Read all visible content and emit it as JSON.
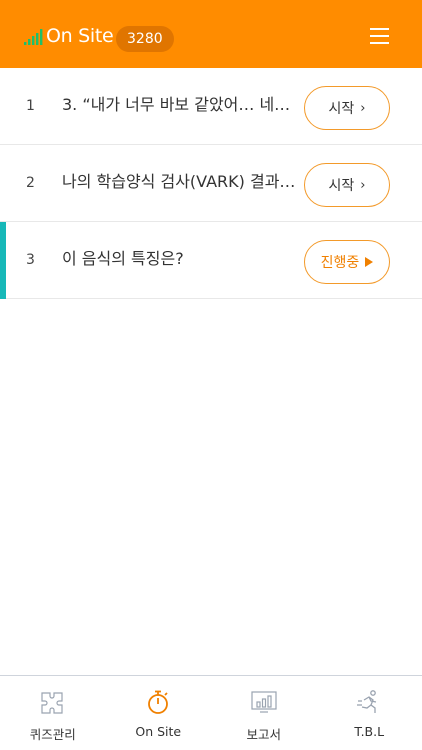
{
  "header": {
    "title": "On Site",
    "badge": "3280",
    "accent_color": "#ff8c00"
  },
  "items": [
    {
      "num": "1",
      "text": "3. “내가 너무 바보 같았어… 네…",
      "button_label": "시작",
      "button_icon": "chevron-right-icon",
      "active": false
    },
    {
      "num": "2",
      "text": "나의 학습양식 검사(VARK) 결과는?",
      "button_label": "시작",
      "button_icon": "chevron-right-icon",
      "active": false
    },
    {
      "num": "3",
      "text": "이 음식의 특징은?",
      "button_label": "진행중",
      "button_icon": "play-icon",
      "active": true
    }
  ],
  "nav": [
    {
      "label": "퀴즈관리",
      "icon": "puzzle-icon",
      "selected": false
    },
    {
      "label": "On Site",
      "icon": "stopwatch-icon",
      "selected": true
    },
    {
      "label": "보고서",
      "icon": "report-chart-icon",
      "selected": false
    },
    {
      "label": "T.B.L",
      "icon": "runner-icon",
      "selected": false
    }
  ],
  "colors": {
    "active_indicator": "#17b8b8",
    "button_border": "#f39a2a",
    "running_text": "#f08000"
  }
}
